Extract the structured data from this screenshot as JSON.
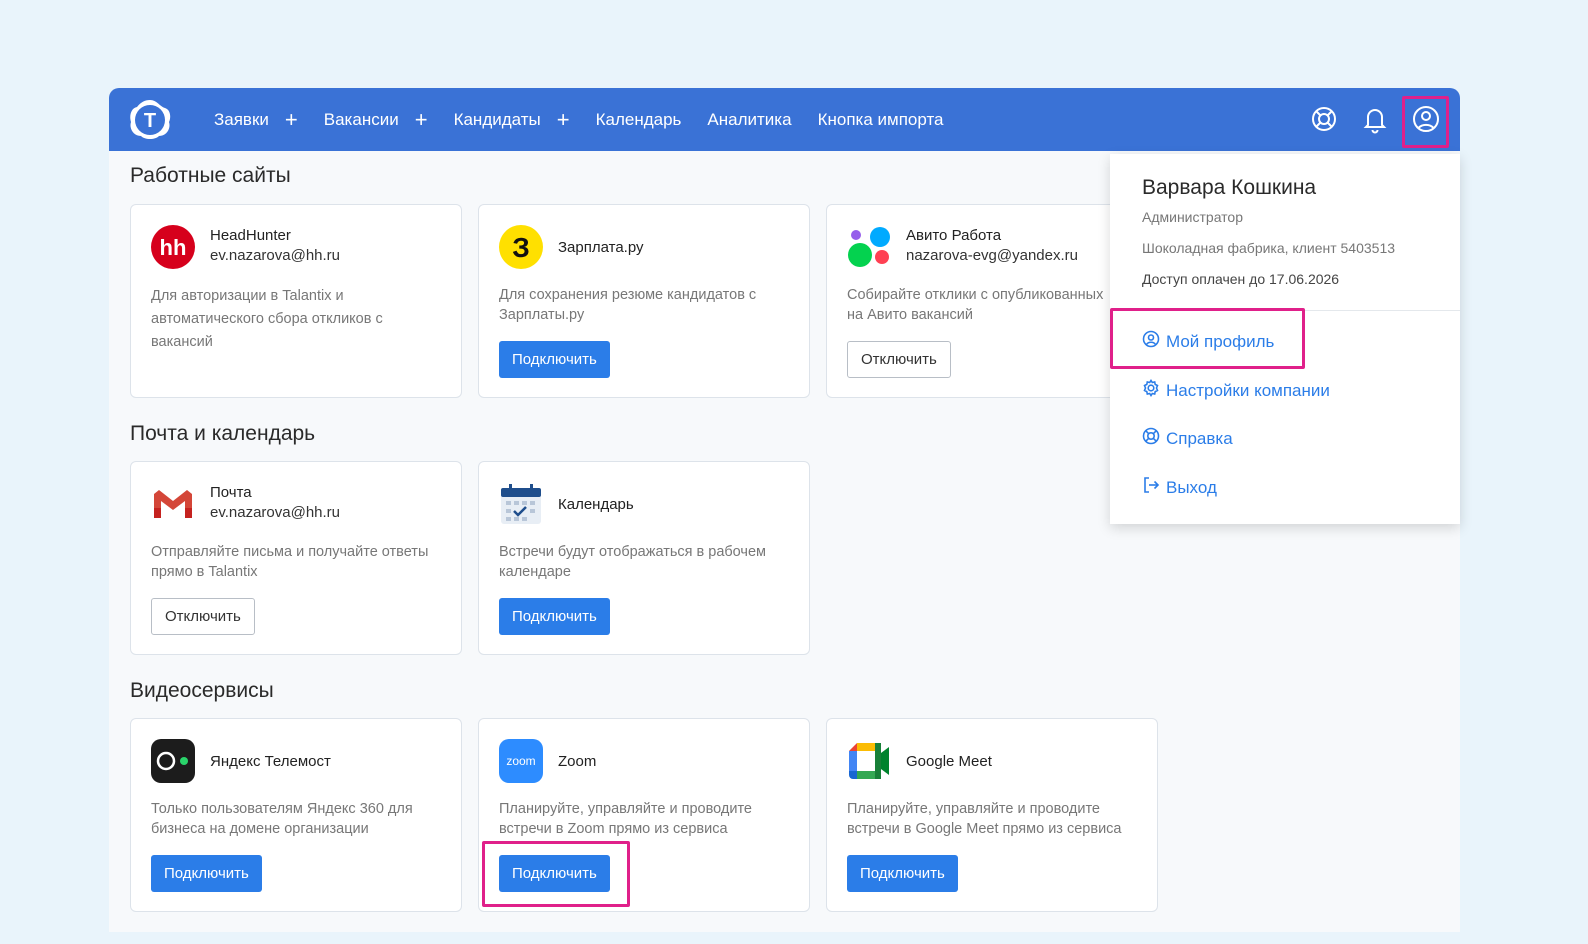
{
  "nav": {
    "logo_letter": "T",
    "items": [
      {
        "label": "Заявки",
        "plus": "+"
      },
      {
        "label": "Вакансии",
        "plus": "+"
      },
      {
        "label": "Кандидаты",
        "plus": "+"
      },
      {
        "label": "Календарь"
      },
      {
        "label": "Аналитика"
      },
      {
        "label": "Кнопка импорта"
      }
    ]
  },
  "sections": {
    "job_sites": "Работные сайты",
    "mail_calendar": "Почта и календарь",
    "video": "Видеосервисы"
  },
  "cards": {
    "hh": {
      "name": "HeadHunter",
      "sub": "ev.nazarova@hh.ru",
      "desc": "Для авторизации в Talantix и автоматического сбора откликов с вакансий",
      "logo": "hh"
    },
    "zarplata": {
      "name": "Зарплата.ру",
      "desc": "Для сохранения резюме кандидатов с Зарплаты.ру",
      "button": "Подключить",
      "logo": "З"
    },
    "avito": {
      "name": "Авито Работа",
      "sub": "nazarova-evg@yandex.ru",
      "desc": "Собирайте отклики с опубликованных на Авито вакансий",
      "button": "Отключить"
    },
    "mail": {
      "name": "Почта",
      "sub": "ev.nazarova@hh.ru",
      "desc": "Отправляйте письма и получайте ответы прямо в Talantix",
      "button": "Отключить"
    },
    "calendar": {
      "name": "Календарь",
      "desc": "Встречи будут отображаться в рабочем календаре",
      "button": "Подключить"
    },
    "telemost": {
      "name": "Яндекс Телемост",
      "desc": "Только пользователям Яндекс 360 для бизнеса на домене организации",
      "button": "Подключить"
    },
    "zoom": {
      "name": "Zoom",
      "desc": "Планируйте, управляйте и проводите встречи в Zoom прямо из сервиса",
      "button": "Подключить",
      "logo": "zoom"
    },
    "meet": {
      "name": "Google Meet",
      "desc": "Планируйте, управляйте и проводите встречи в Google Meet прямо из сервиса",
      "button": "Подключить"
    }
  },
  "profile_menu": {
    "name": "Варвара Кошкина",
    "role": "Администратор",
    "company": "Шоколадная фабрика, клиент 5403513",
    "access": "Доступ оплачен до 17.06.2026",
    "items": [
      {
        "label": "Мой профиль",
        "icon": "user-circle-icon"
      },
      {
        "label": "Настройки компании",
        "icon": "gear-icon"
      },
      {
        "label": "Справка",
        "icon": "lifebuoy-icon"
      },
      {
        "label": "Выход",
        "icon": "logout-icon"
      }
    ]
  },
  "colors": {
    "topbar": "#3a72d6",
    "primary_button": "#2b7de8",
    "highlight": "#e0208a",
    "link": "#2b7de8"
  }
}
